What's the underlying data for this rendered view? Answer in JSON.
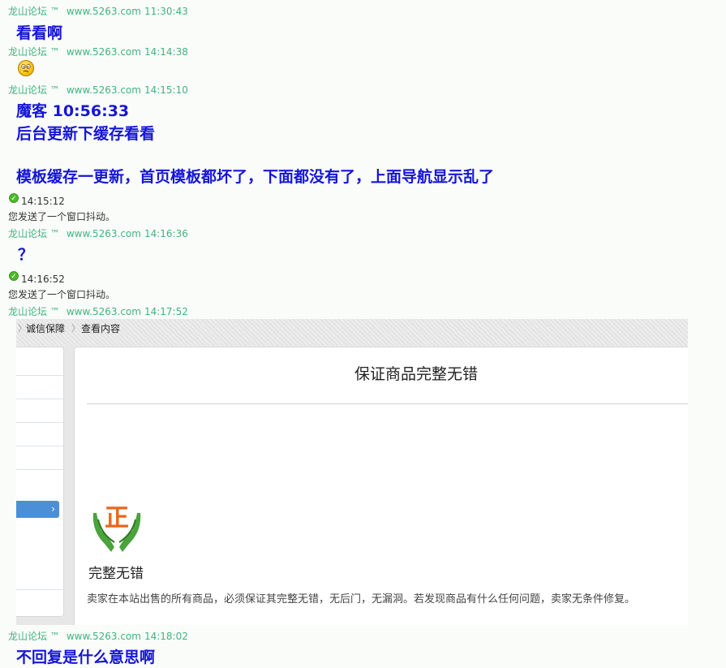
{
  "messages": [
    {
      "sender": "龙山论坛 ™",
      "site": "www.5263.com",
      "time": "11:30:43",
      "lines": [
        "看看啊"
      ]
    },
    {
      "sender": "龙山论坛 ™",
      "site": "www.5263.com",
      "time": "14:14:38",
      "emoji": "confused-face-emoji"
    },
    {
      "sender": "龙山论坛 ™",
      "site": "www.5263.com",
      "time": "14:15:10",
      "lines": [
        "魔客 10:56:33",
        "后台更新下缓存看看",
        "模板缓存一更新，首页模板都坏了，下面都没有了，上面导航显示乱了"
      ]
    },
    {
      "system": true,
      "time": "14:15:12",
      "text": "您发送了一个窗口抖动。"
    },
    {
      "sender": "龙山论坛 ™",
      "site": "www.5263.com",
      "time": "14:16:36",
      "lines": [
        "？"
      ]
    },
    {
      "system": true,
      "time": "14:16:52",
      "text": "您发送了一个窗口抖动。"
    },
    {
      "sender": "龙山论坛 ™",
      "site": "www.5263.com",
      "time": "14:17:52",
      "image": true
    },
    {
      "sender": "龙山论坛 ™",
      "site": "www.5263.com",
      "time": "14:18:02",
      "lines": [
        "不回复是什么意思啊"
      ]
    }
  ],
  "screenshot": {
    "breadcrumb": [
      "诚信保障",
      "查看内容"
    ],
    "title": "保证商品完整无错",
    "icon_glyph": "正",
    "icon_caption": "完整无错",
    "description": "卖家在本站出售的所有商品，必须保证其完整无错，无后门，无漏洞。若发现商品有什么任何问题，卖家无条件修复。",
    "nav_chevron": "›"
  },
  "colors": {
    "sender": "#3fb37f",
    "message": "#1515d8",
    "nav_active": "#4b8fd6"
  }
}
